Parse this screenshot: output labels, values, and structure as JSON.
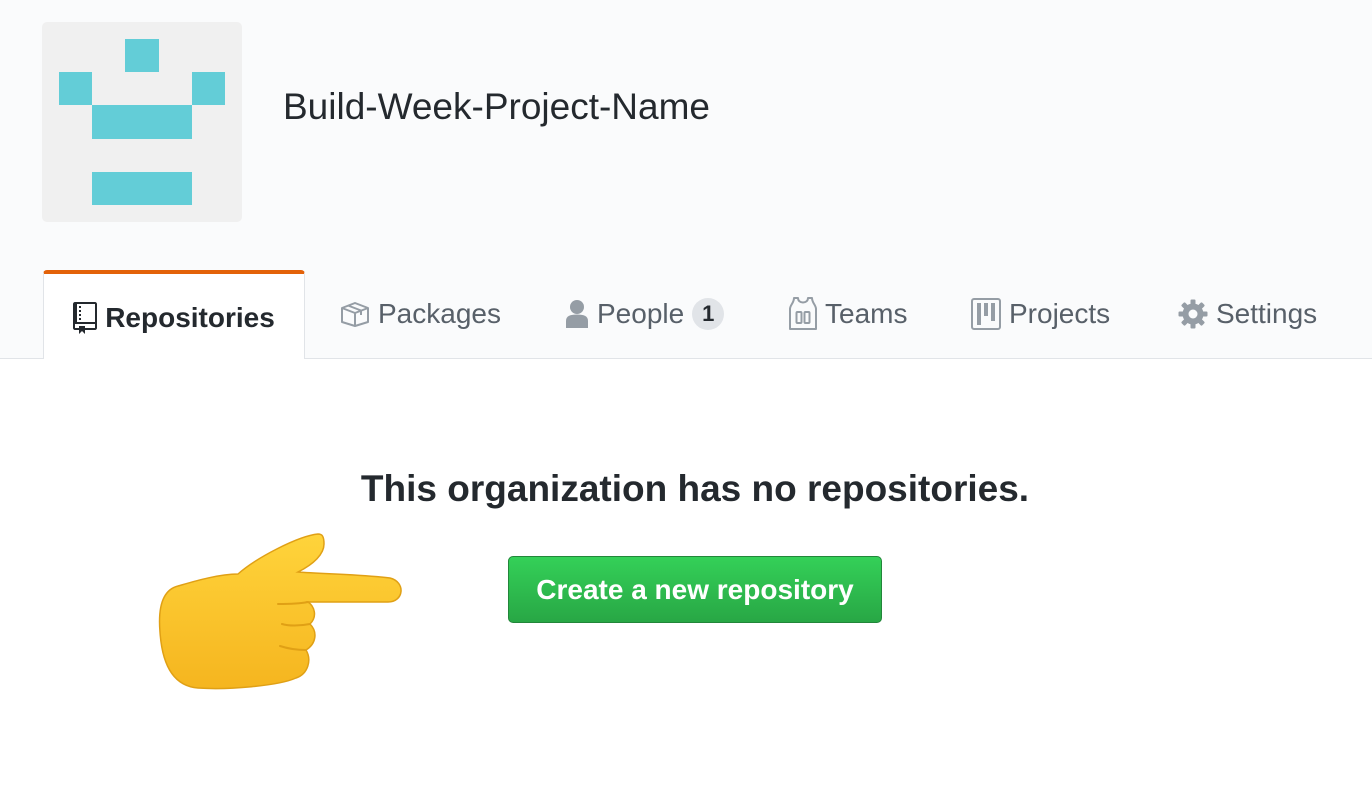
{
  "org": {
    "name": "Build-Week-Project-Name",
    "avatar_color": "#63cdd7"
  },
  "tabs": [
    {
      "label": "Repositories",
      "icon": "repo-icon",
      "selected": true
    },
    {
      "label": "Packages",
      "icon": "package-icon",
      "selected": false
    },
    {
      "label": "People",
      "icon": "person-icon",
      "selected": false,
      "count": "1"
    },
    {
      "label": "Teams",
      "icon": "jersey-icon",
      "selected": false
    },
    {
      "label": "Projects",
      "icon": "project-icon",
      "selected": false
    },
    {
      "label": "Settings",
      "icon": "gear-icon",
      "selected": false
    }
  ],
  "blankslate": {
    "title": "This organization has no repositories.",
    "button_label": "Create a new repository",
    "pointer_emoji": "backhand-index-pointing-right"
  },
  "colors": {
    "tab_accent": "#e36209",
    "button_green": "#2ea44f"
  }
}
